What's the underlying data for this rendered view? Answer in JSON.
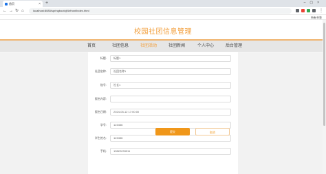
{
  "browser": {
    "tab_title": "首页",
    "url": "localhost:8080/springbootxjf4r/front/index.html",
    "bookmarks": "所有书签"
  },
  "site": {
    "title": "校园社团信息管理"
  },
  "nav": {
    "items": [
      {
        "label": "首页",
        "active": false
      },
      {
        "label": "社团信息",
        "active": false
      },
      {
        "label": "社团活动",
        "active": true
      },
      {
        "label": "社团新闻",
        "active": false
      },
      {
        "label": "个人中心",
        "active": false
      },
      {
        "label": "后台管理",
        "active": false
      }
    ]
  },
  "form": {
    "fields": [
      {
        "label": "标题:",
        "value": "标题1"
      },
      {
        "label": "社团名称:",
        "value": "社团名称1"
      },
      {
        "label": "账号:",
        "value": "社长1"
      },
      {
        "label": "报名内容:",
        "value": ""
      },
      {
        "label": "报名日期:",
        "value": "2024-05-12 17:00:00"
      },
      {
        "label": "学号:",
        "value": "123456"
      },
      {
        "label": "学生姓名:",
        "value": "123456"
      },
      {
        "label": "手机:",
        "value": "19822233311"
      }
    ],
    "save_label": "提交",
    "cancel_label": "取消"
  }
}
